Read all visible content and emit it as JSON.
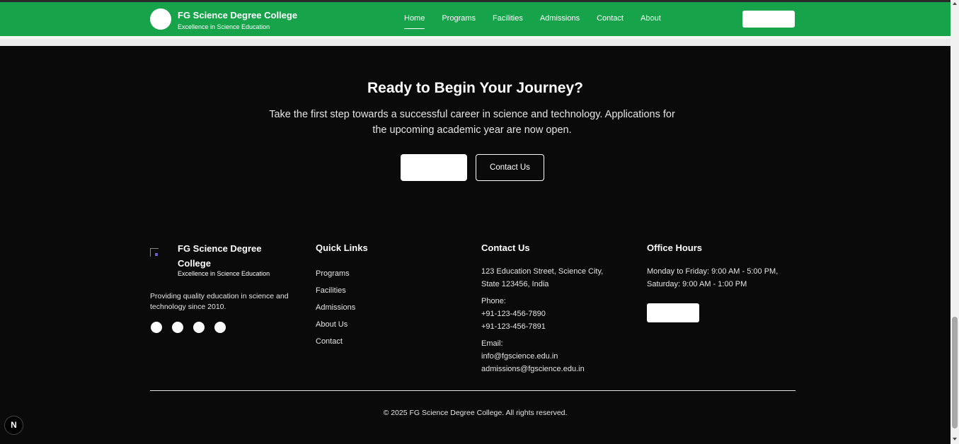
{
  "navbar": {
    "brand_title": "FG Science Degree College",
    "brand_subtitle": "Excellence in Science Education",
    "links": [
      "Home",
      "Programs",
      "Facilities",
      "Admissions",
      "Contact",
      "About"
    ],
    "active_link": "Home",
    "bg_color": "#16a34a"
  },
  "cta": {
    "title": "Ready to Begin Your Journey?",
    "text": "Take the first step towards a successful career in science and technology. Applications for the upcoming academic year are now open.",
    "contact_button": "Contact Us"
  },
  "footer": {
    "brand_title": "FG Science Degree College",
    "brand_subtitle": "Excellence in Science Education",
    "description": "Providing quality education in science and technology since 2010.",
    "quick_links": {
      "heading": "Quick Links",
      "items": [
        "Programs",
        "Facilities",
        "Admissions",
        "About Us",
        "Contact"
      ]
    },
    "contact": {
      "heading": "Contact Us",
      "address": "123 Education Street, Science City, State 123456, India",
      "phone_label": "Phone:",
      "phones": [
        "+91-123-456-7890",
        "+91-123-456-7891"
      ],
      "email_label": "Email:",
      "emails": [
        "info@fgscience.edu.in",
        "admissions@fgscience.edu.in"
      ]
    },
    "hours": {
      "heading": "Office Hours",
      "text": "Monday to Friday: 9:00 AM - 5:00 PM, Saturday: 9:00 AM - 1:00 PM"
    },
    "copyright": "© 2025 FG Science Degree College. All rights reserved."
  },
  "dev_badge": "N"
}
